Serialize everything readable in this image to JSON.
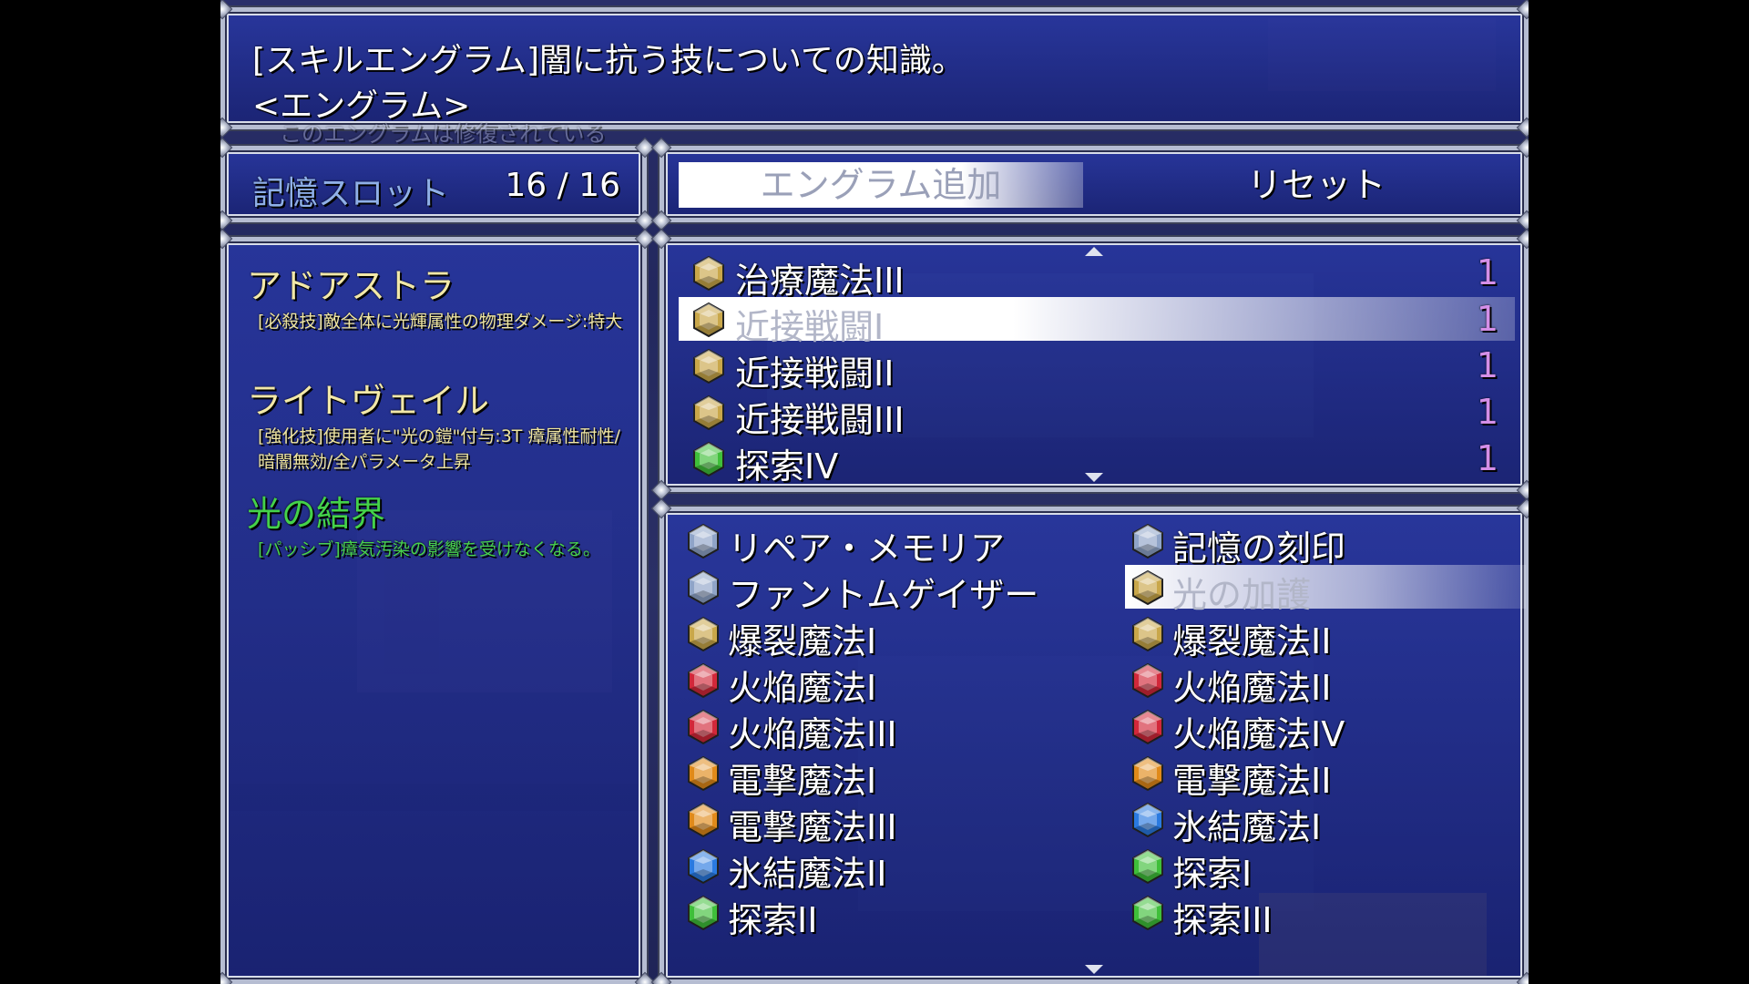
{
  "help": {
    "line1": "[スキルエングラム]闇に抗う技についての知識。",
    "line2": "<エングラム>",
    "line3": "このエングラムは修復されている"
  },
  "slot": {
    "label": "記憶スロット",
    "count": "16 / 16"
  },
  "commands": {
    "add": "エングラム追加",
    "reset": "リセット"
  },
  "skills": [
    {
      "name": "アドアストラ",
      "desc": "[必殺技]敵全体に光輝属性の物理ダメージ:特大",
      "color": "#f2e8a8"
    },
    {
      "name": "ライトヴェイル",
      "desc": "[強化技]使用者に\"光の鎧\"付与:3T 瘴属性耐性/暗闇無効/全パラメータ上昇",
      "color": "#f2e8a8"
    },
    {
      "name": "光の結界",
      "desc": "[パッシブ]瘴気汚染の影響を受けなくなる。",
      "color": "#44d24a"
    }
  ],
  "equipped": [
    {
      "name": "治療魔法III",
      "cost": "1",
      "gem": "gold",
      "selected": false
    },
    {
      "name": "近接戦闘I",
      "cost": "1",
      "gem": "gold",
      "selected": true
    },
    {
      "name": "近接戦闘II",
      "cost": "1",
      "gem": "gold",
      "selected": false
    },
    {
      "name": "近接戦闘III",
      "cost": "1",
      "gem": "gold",
      "selected": false
    },
    {
      "name": "探索IV",
      "cost": "1",
      "gem": "green",
      "selected": false
    }
  ],
  "available": [
    {
      "name": "リペア・メモリア",
      "gem": "silver",
      "selected": false
    },
    {
      "name": "記憶の刻印",
      "gem": "silver",
      "selected": false
    },
    {
      "name": "ファントムゲイザー",
      "gem": "silver",
      "selected": false
    },
    {
      "name": "光の加護",
      "gem": "gold",
      "selected": true
    },
    {
      "name": "爆裂魔法I",
      "gem": "gold",
      "selected": false
    },
    {
      "name": "爆裂魔法II",
      "gem": "gold",
      "selected": false
    },
    {
      "name": "火焔魔法I",
      "gem": "red",
      "selected": false
    },
    {
      "name": "火焔魔法II",
      "gem": "red",
      "selected": false
    },
    {
      "name": "火焔魔法III",
      "gem": "red",
      "selected": false
    },
    {
      "name": "火焔魔法IV",
      "gem": "red",
      "selected": false
    },
    {
      "name": "電撃魔法I",
      "gem": "orange",
      "selected": false
    },
    {
      "name": "電撃魔法II",
      "gem": "orange",
      "selected": false
    },
    {
      "name": "電撃魔法III",
      "gem": "orange",
      "selected": false
    },
    {
      "name": "氷結魔法I",
      "gem": "blue",
      "selected": false
    },
    {
      "name": "氷結魔法II",
      "gem": "blue",
      "selected": false
    },
    {
      "name": "探索I",
      "gem": "green",
      "selected": false
    },
    {
      "name": "探索II",
      "gem": "green",
      "selected": false
    },
    {
      "name": "探索III",
      "gem": "green",
      "selected": false
    }
  ],
  "colors": {
    "gold": "#c9a74a",
    "silver": "#8fa4c8",
    "green": "#3fbf3a",
    "red": "#d2283a",
    "orange": "#e08a1a",
    "blue": "#2a7ae0",
    "cost": "#d48fe8"
  }
}
